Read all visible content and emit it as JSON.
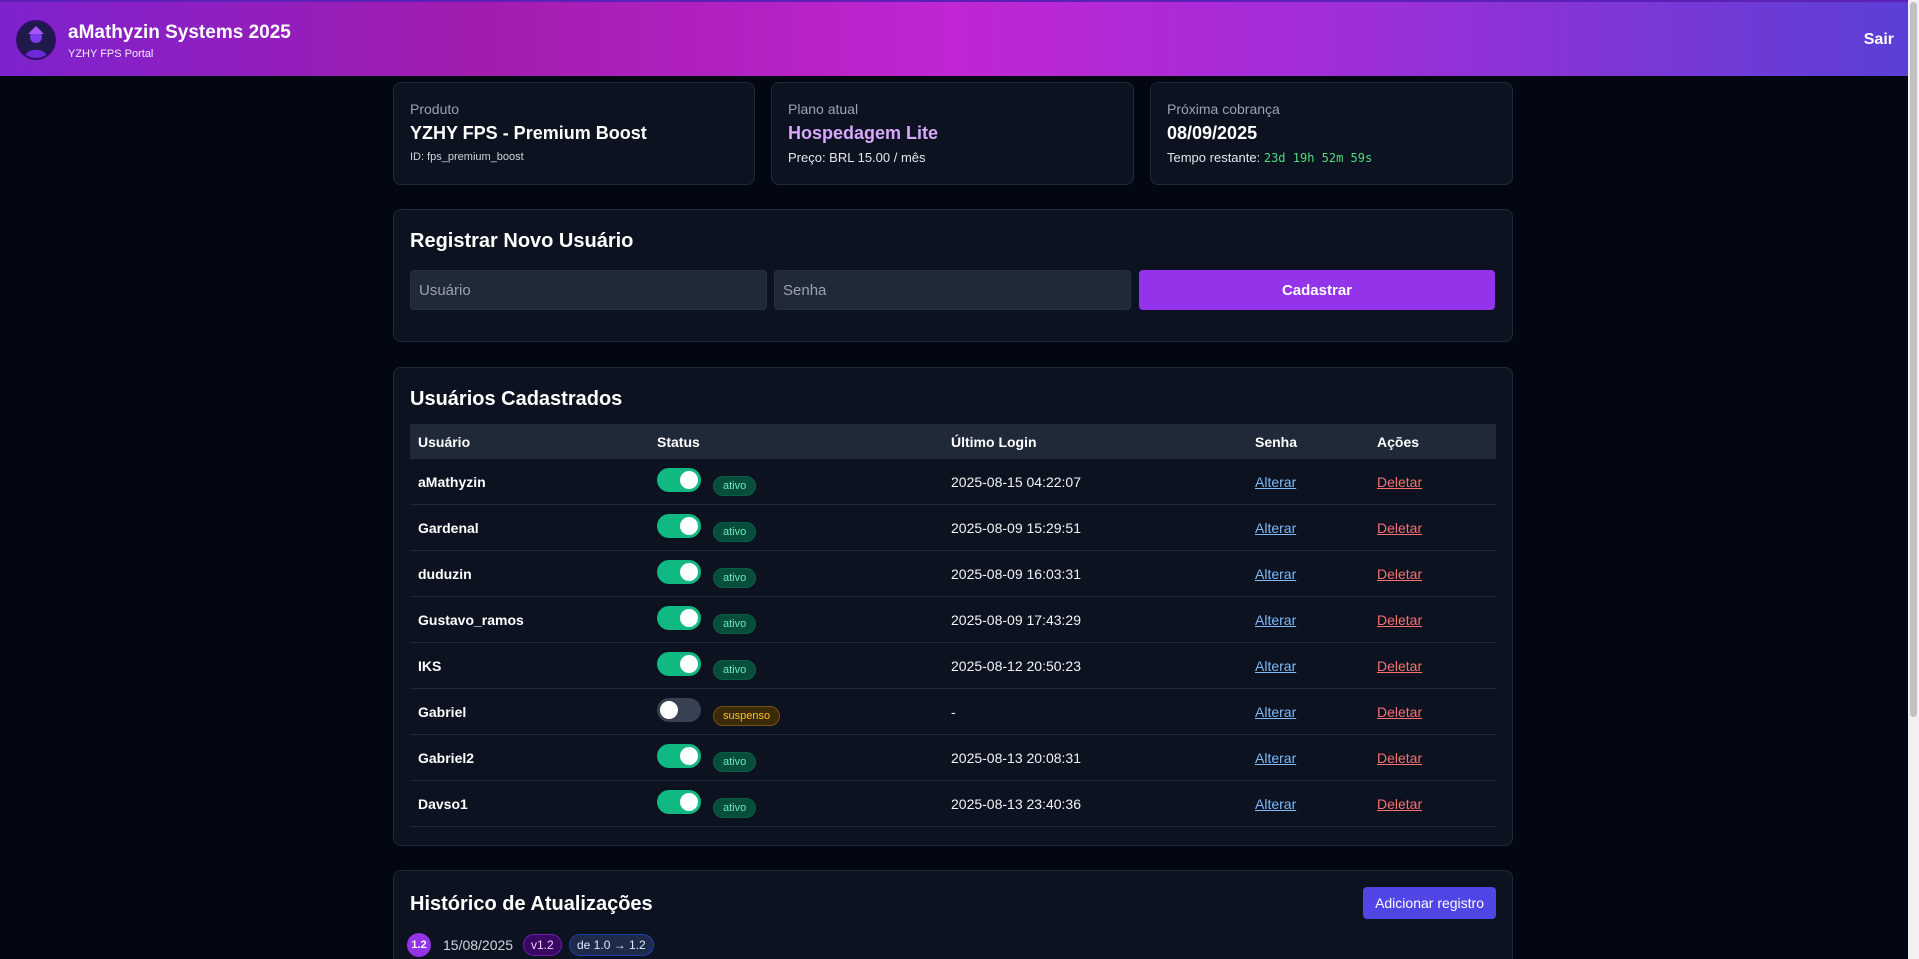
{
  "header": {
    "title": "aMathyzin Systems 2025",
    "subtitle": "YZHY FPS Portal",
    "logout_label": "Sair"
  },
  "info": {
    "product": {
      "label": "Produto",
      "value": "YZHY FPS - Premium Boost",
      "sub": "ID: fps_premium_boost"
    },
    "plan": {
      "label": "Plano atual",
      "value": "Hospedagem Lite",
      "sub": "Preço: BRL 15.00 / mês"
    },
    "billing": {
      "label": "Próxima cobrança",
      "value": "08/09/2025",
      "sub_label": "Tempo restante:",
      "countdown": "23d 19h 52m 59s"
    }
  },
  "register": {
    "title": "Registrar Novo Usuário",
    "user_placeholder": "Usuário",
    "password_placeholder": "Senha",
    "submit_label": "Cadastrar"
  },
  "users": {
    "title": "Usuários Cadastrados",
    "columns": [
      "Usuário",
      "Status",
      "Último Login",
      "Senha",
      "Ações"
    ],
    "alter_label": "Alterar",
    "delete_label": "Deletar",
    "rows": [
      {
        "name": "aMathyzin",
        "enabled": true,
        "status": "ativo",
        "last_login": "2025-08-15 04:22:07"
      },
      {
        "name": "Gardenal",
        "enabled": true,
        "status": "ativo",
        "last_login": "2025-08-09 15:29:51"
      },
      {
        "name": "duduzin",
        "enabled": true,
        "status": "ativo",
        "last_login": "2025-08-09 16:03:31"
      },
      {
        "name": "Gustavo_ramos",
        "enabled": true,
        "status": "ativo",
        "last_login": "2025-08-09 17:43:29"
      },
      {
        "name": "IKS",
        "enabled": true,
        "status": "ativo",
        "last_login": "2025-08-12 20:50:23"
      },
      {
        "name": "Gabriel",
        "enabled": false,
        "status": "suspenso",
        "last_login": "-"
      },
      {
        "name": "Gabriel2",
        "enabled": true,
        "status": "ativo",
        "last_login": "2025-08-13 20:08:31"
      },
      {
        "name": "Davso1",
        "enabled": true,
        "status": "ativo",
        "last_login": "2025-08-13 23:40:36"
      }
    ]
  },
  "history": {
    "title": "Histórico de Atualizações",
    "add_label": "Adicionar registro",
    "entries": [
      {
        "badge": "1.2",
        "date": "15/08/2025",
        "version": "v1.2",
        "range": "de 1.0 → 1.2"
      }
    ]
  },
  "colors": {
    "accent": "#9333ea",
    "success": "#10b981",
    "warning": "#fbbf24",
    "danger": "#f87171",
    "link": "#7db9f5"
  }
}
